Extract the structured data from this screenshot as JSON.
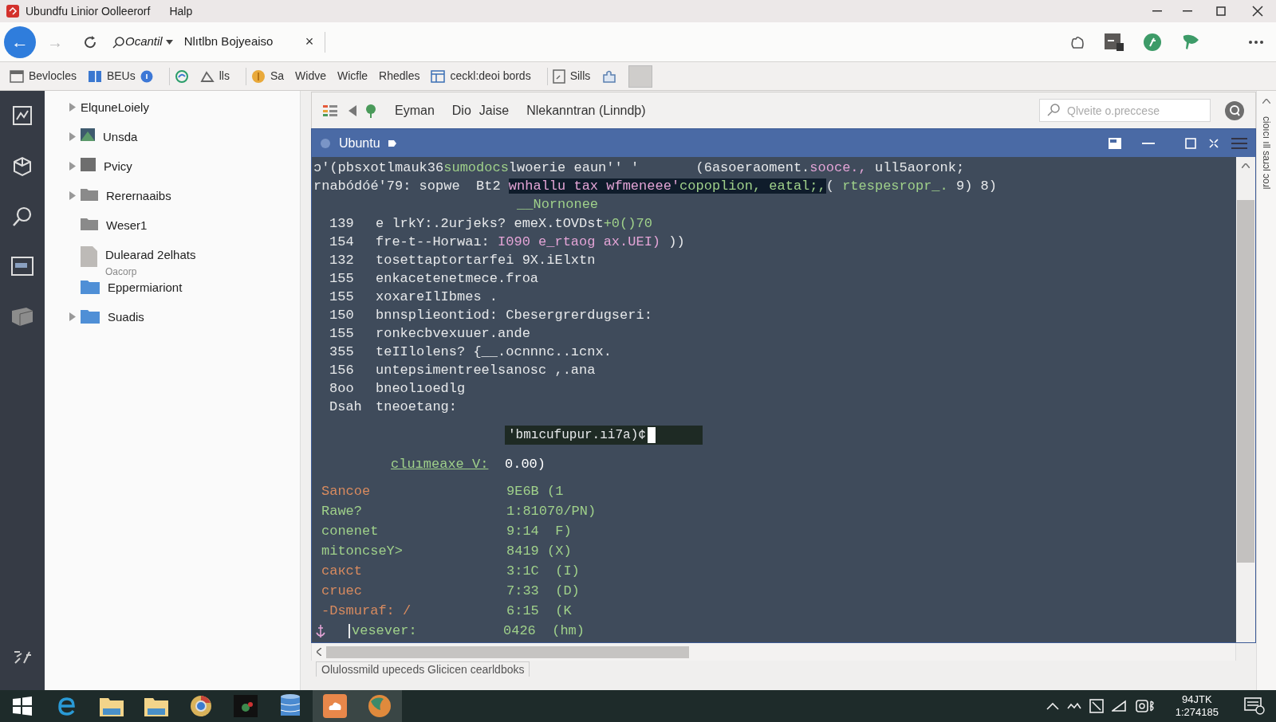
{
  "window": {
    "title": "Ubundfu Linior Oolleerorf",
    "menu": [
      "Halp"
    ]
  },
  "nav": {
    "back_label": "←",
    "forward_label": "→",
    "address_prefix": "Ocantil",
    "address": "Nlıtlbn Bojyeaiso",
    "clear": "×"
  },
  "bookmarks": [
    {
      "label": "Bevlocles",
      "badge": false
    },
    {
      "label": "BEUs",
      "badge": true
    },
    {
      "badge": false
    },
    {
      "label": "lls",
      "badge": false
    },
    {
      "label": "Sa",
      "badge": false
    },
    {
      "label": "Widve",
      "badge": false
    },
    {
      "label": "Wicfle",
      "badge": false
    },
    {
      "label": "Rhedles",
      "badge": false
    },
    {
      "label": "ceckl:deoi bords",
      "badge": false
    },
    {
      "label": "Sills",
      "badge": false
    },
    {
      "badge": false
    }
  ],
  "sidebar": {
    "items": [
      {
        "label": "ElquneLoiely",
        "kind": "plain",
        "arrow": true
      },
      {
        "label": "Unsda",
        "kind": "image",
        "arrow": true
      },
      {
        "label": "Pvicy",
        "kind": "folder-dark",
        "arrow": true
      },
      {
        "label": "Rerernaaibs",
        "kind": "folder-gray",
        "arrow": true
      },
      {
        "label": "Weser1",
        "kind": "folder-gray",
        "arrow": false
      },
      {
        "label": "Dulearad 2elhats",
        "sublabel": "Oacorp",
        "kind": "doc-gray",
        "arrow": false
      },
      {
        "label": "Eppermiariont",
        "kind": "folder-blue",
        "arrow": false
      },
      {
        "label": "Suadis",
        "kind": "folder-blue",
        "arrow": true
      }
    ]
  },
  "panel": {
    "tabs": [
      "Eyman",
      "Dio",
      "Jaise",
      "Nlekanntran (Linndþ)"
    ],
    "search": {
      "placeholder": "Qlveite o.preccese"
    },
    "title": "Ubuntu"
  },
  "terminal": {
    "header_lines": [
      [
        {
          "text": "ɔ'(pbsxotlmauk36",
          "kind": "text"
        },
        {
          "text": "sumodocs",
          "kind": "green"
        },
        {
          "text": "lwoerie eaun'' '       ",
          "kind": "text"
        },
        {
          "text": "(6asoeraoment.",
          "kind": "text"
        },
        {
          "text": "sooce.,",
          "kind": "pink"
        },
        {
          "text": " ull5aoronk;",
          "kind": "text"
        }
      ],
      [
        {
          "text": "rnabódóé'79: sopwe  Bt2 ",
          "kind": "text"
        },
        {
          "text": "wnhallu tax wfmeneee'",
          "kind": "mark"
        },
        {
          "text": "copoplion, eatal;,",
          "kind": "markgreen"
        },
        {
          "text": "( ",
          "kind": "text"
        },
        {
          "text": "rtespesropr_.",
          "kind": "green"
        },
        {
          "text": " 9) 8)",
          "kind": "text"
        }
      ],
      [
        {
          "text": "                         __Nornonee",
          "kind": "green"
        }
      ]
    ],
    "code_lines": [
      {
        "number": "139",
        "segments": [
          {
            "text": "e lrkY:.2urjeks? ",
            "kind": "text"
          },
          {
            "text": "emeX.tOVDst",
            "kind": "text"
          },
          {
            "text": "+0()70",
            "kind": "green"
          }
        ]
      },
      {
        "number": "154",
        "segments": [
          {
            "text": "fre-t--Horwaı: ",
            "kind": "text"
          },
          {
            "text": "I090 e_rtaog ax.UEI)",
            "kind": "pink"
          },
          {
            "text": " ))",
            "kind": "text"
          }
        ]
      },
      {
        "number": "132",
        "segments": [
          {
            "text": "tosettaptortarfei 9X.iElxtn",
            "kind": "text"
          }
        ]
      },
      {
        "number": "155",
        "segments": [
          {
            "text": "enkacetenetmece.froa",
            "kind": "text"
          }
        ]
      },
      {
        "number": "155",
        "segments": [
          {
            "text": "xoxareIlIbmes .",
            "kind": "text"
          }
        ]
      },
      {
        "number": "150",
        "segments": [
          {
            "text": "bnnsplieontiod: Cbesergrerdugseri:",
            "kind": "text"
          }
        ]
      },
      {
        "number": "155",
        "segments": [
          {
            "text": "ronkecbvexuuer.ande",
            "kind": "text"
          }
        ]
      },
      {
        "number": "355",
        "segments": [
          {
            "text": "teIIlolens? {__.ocnnnc..ıcnx.",
            "kind": "text"
          }
        ]
      },
      {
        "number": "156",
        "segments": [
          {
            "text": "untepsimentreelsanosc ,.ana",
            "kind": "text"
          }
        ]
      },
      {
        "number": "8oo",
        "segments": [
          {
            "text": "bneolıoedlg",
            "kind": "text"
          }
        ]
      },
      {
        "number": "Dsah",
        "segments": [
          {
            "text": "tneoetang:",
            "kind": "text"
          }
        ]
      }
    ],
    "prompt": "'bmıcufupur.ıi7a)¢",
    "summary": {
      "label": "cluımeaxe V:",
      "value": "0.00)"
    },
    "stats": [
      {
        "key": "Sancoe",
        "value": "9E6B (1",
        "color": "#d98b5f"
      },
      {
        "key": "Rawe?",
        "value": "1:81070/PN)",
        "color": "#9fd08a"
      },
      {
        "key": "conenet",
        "value": "9:14  F)",
        "color": "#9fd08a"
      },
      {
        "key": "mitoncseY>",
        "value": "8419 (X)",
        "color": "#9fd08a"
      },
      {
        "key": "caкct",
        "value": "3:1C  (I)",
        "color": "#d98b5f"
      },
      {
        "key": "cruec",
        "value": "7:33  (D)",
        "color": "#d98b5f"
      },
      {
        "key": "-Dsmuraf: /",
        "value": "6:15  (K",
        "color": "#d98b5f"
      },
      {
        "key": "vesever:",
        "value": "0426  (hm)",
        "color": "#9fd08a"
      }
    ]
  },
  "status": "Olulossmild upeceds Glicicen cearldboks",
  "side_text": "cioıcı ıll saɹɔl ɔoɹl",
  "tray": {
    "time": "94JTK",
    "date": "1:274185"
  }
}
